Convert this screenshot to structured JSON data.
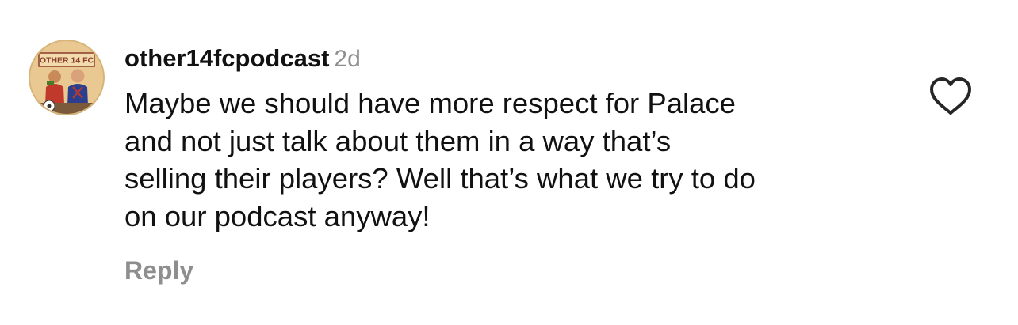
{
  "comment": {
    "avatar": {
      "label": "OTHER 14 FC",
      "icon": "podcast-avatar-icon"
    },
    "username": "other14fcpodcast",
    "timestamp": "2d",
    "text": "Maybe we should have more respect for Palace\nand not just talk about them in a way that’s\nselling their players? Well that’s what we try to do\non our podcast anyway!",
    "reply_label": "Reply",
    "like_icon": "heart-icon"
  },
  "colors": {
    "primary_text": "#111111",
    "secondary_text": "#8e8e8e",
    "avatar_bg": "#e9c891"
  }
}
